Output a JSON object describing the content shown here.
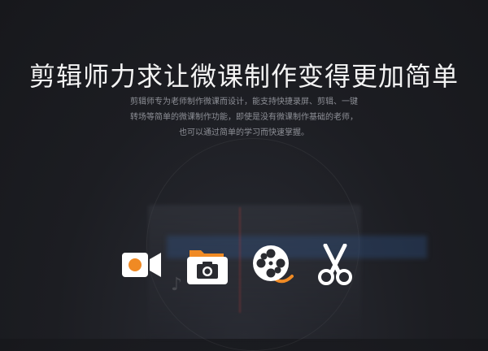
{
  "headline": "剪辑师力求让微课制作变得更加简单",
  "description": {
    "line1": "剪辑师专为老师制作微课而设计，能支持快捷录屏、剪辑、一键",
    "line2": "转场等简单的微课制作功能，即使是没有微课制作基础的老师，",
    "line3": "也可以通过简单的学习而快速掌握。"
  },
  "features": [
    {
      "icon": "video-camera-icon"
    },
    {
      "icon": "folder-camera-icon"
    },
    {
      "icon": "film-reel-icon"
    },
    {
      "icon": "scissors-icon"
    }
  ],
  "colors": {
    "accent": "#f08a24",
    "icon_white": "#ffffff",
    "background": "#1c1d22"
  }
}
